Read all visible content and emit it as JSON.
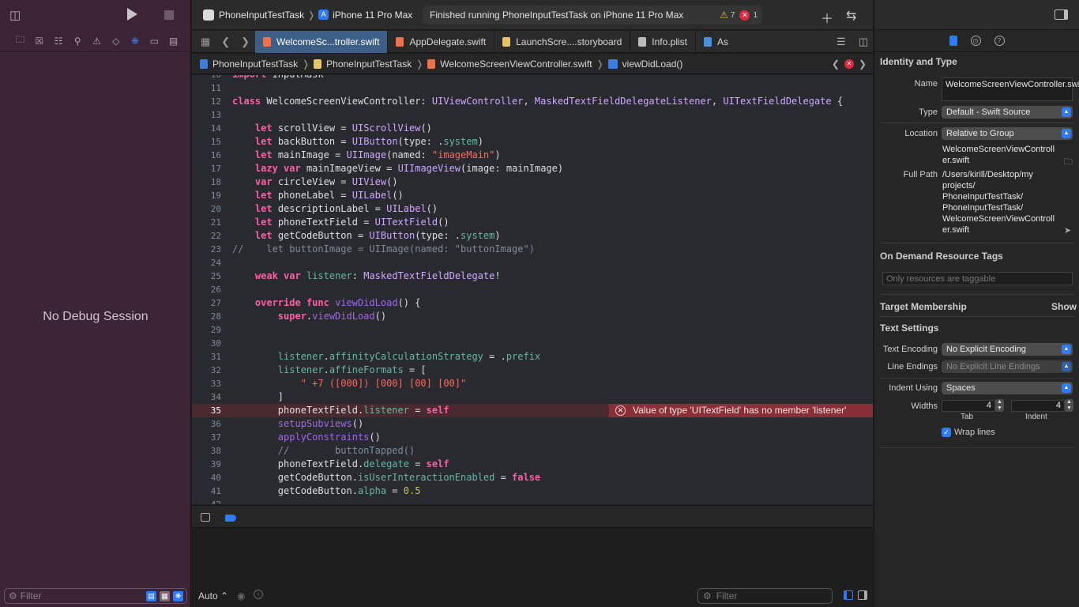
{
  "debug_nav": {
    "no_debug_label": "No Debug Session",
    "filter_placeholder": "Filter"
  },
  "toolbar": {
    "project": "PhoneInputTestTask",
    "device": "iPhone 11 Pro Max",
    "status_message": "Finished running PhoneInputTestTask on iPhone 11 Pro Max",
    "warning_count": "7",
    "error_count": "1"
  },
  "tabs": [
    {
      "label": "WelcomeSc...troller.swift",
      "active": true
    },
    {
      "label": "AppDelegate.swift",
      "active": false
    },
    {
      "label": "LaunchScre....storyboard",
      "active": false
    },
    {
      "label": "Info.plist",
      "active": false
    },
    {
      "label": "As",
      "active": false
    }
  ],
  "jumpbar": {
    "crumbs": [
      "PhoneInputTestTask",
      "PhoneInputTestTask",
      "WelcomeScreenViewController.swift",
      "viewDidLoad()"
    ]
  },
  "editor": {
    "lines": [
      {
        "n": "10",
        "text": "import InputMask"
      },
      {
        "n": "11",
        "text": ""
      },
      {
        "n": "12",
        "text": "class WelcomeScreenViewController: UIViewController, MaskedTextFieldDelegateListener, UITextFieldDelegate {"
      },
      {
        "n": "13",
        "text": ""
      },
      {
        "n": "14",
        "text": "    let scrollView = UIScrollView()"
      },
      {
        "n": "15",
        "text": "    let backButton = UIButton(type: .system)"
      },
      {
        "n": "16",
        "text": "    let mainImage = UIImage(named: \"imageMain\")"
      },
      {
        "n": "17",
        "text": "    lazy var mainImageView = UIImageView(image: mainImage)"
      },
      {
        "n": "18",
        "text": "    var circleView = UIView()"
      },
      {
        "n": "19",
        "text": "    let phoneLabel = UILabel()"
      },
      {
        "n": "20",
        "text": "    let descriptionLabel = UILabel()"
      },
      {
        "n": "21",
        "text": "    let phoneTextField = UITextField()"
      },
      {
        "n": "22",
        "text": "    let getCodeButton = UIButton(type: .system)"
      },
      {
        "n": "23",
        "text": "//    let buttonImage = UIImage(named: \"buttonImage\")"
      },
      {
        "n": "24",
        "text": ""
      },
      {
        "n": "25",
        "text": "    weak var listener: MaskedTextFieldDelegate!"
      },
      {
        "n": "26",
        "text": ""
      },
      {
        "n": "27",
        "text": "    override func viewDidLoad() {"
      },
      {
        "n": "28",
        "text": "        super.viewDidLoad()"
      },
      {
        "n": "29",
        "text": ""
      },
      {
        "n": "30",
        "text": ""
      },
      {
        "n": "31",
        "text": "        listener.affinityCalculationStrategy = .prefix"
      },
      {
        "n": "32",
        "text": "        listener.affineFormats = ["
      },
      {
        "n": "33",
        "text": "            \" +7 ([000]) [000] [00] [00]\""
      },
      {
        "n": "34",
        "text": "        ]"
      },
      {
        "n": "35",
        "text": "        phoneTextField.listener = self"
      },
      {
        "n": "36",
        "text": "        setupSubviews()"
      },
      {
        "n": "37",
        "text": "        applyConstraints()"
      },
      {
        "n": "38",
        "text": "        //        buttonTapped()"
      },
      {
        "n": "39",
        "text": "        phoneTextField.delegate = self"
      },
      {
        "n": "40",
        "text": "        getCodeButton.isUserInteractionEnabled = false"
      },
      {
        "n": "41",
        "text": "        getCodeButton.alpha = 0.5"
      },
      {
        "n": "42",
        "text": ""
      }
    ],
    "error_line": "35",
    "error_message": "Value of type 'UITextField' has no member 'listener'"
  },
  "console": {
    "auto_label": "Auto ⌃",
    "filter_placeholder": "Filter"
  },
  "inspector": {
    "identity_title": "Identity and Type",
    "name_label": "Name",
    "name_value": "WelcomeScreenViewController.swift",
    "type_label": "Type",
    "type_value": "Default - Swift Source",
    "location_label": "Location",
    "location_value": "Relative to Group",
    "location_file": "WelcomeScreenViewControll er.swift",
    "fullpath_label": "Full Path",
    "fullpath_value": "/Users/kirill/Desktop/my projects/ PhoneInputTestTask/ PhoneInputTestTask/ WelcomeScreenViewControll er.swift",
    "ondemand_title": "On Demand Resource Tags",
    "ondemand_placeholder": "Only resources are taggable",
    "target_title": "Target Membership",
    "show_label": "Show",
    "text_settings_title": "Text Settings",
    "encoding_label": "Text Encoding",
    "encoding_value": "No Explicit Encoding",
    "line_endings_label": "Line Endings",
    "line_endings_value": "No Explicit Line Endings",
    "indent_using_label": "Indent Using",
    "indent_using_value": "Spaces",
    "widths_label": "Widths",
    "tab_width": "4",
    "indent_width": "4",
    "tab_label": "Tab",
    "indent_label": "Indent",
    "wrap_label": "Wrap lines",
    "wrap_checked": true
  },
  "colors": {
    "accent": "#2f7bf6",
    "error": "#e0283e",
    "debug_nav_bg": "#3a2436",
    "editor_bg": "#292a30"
  }
}
